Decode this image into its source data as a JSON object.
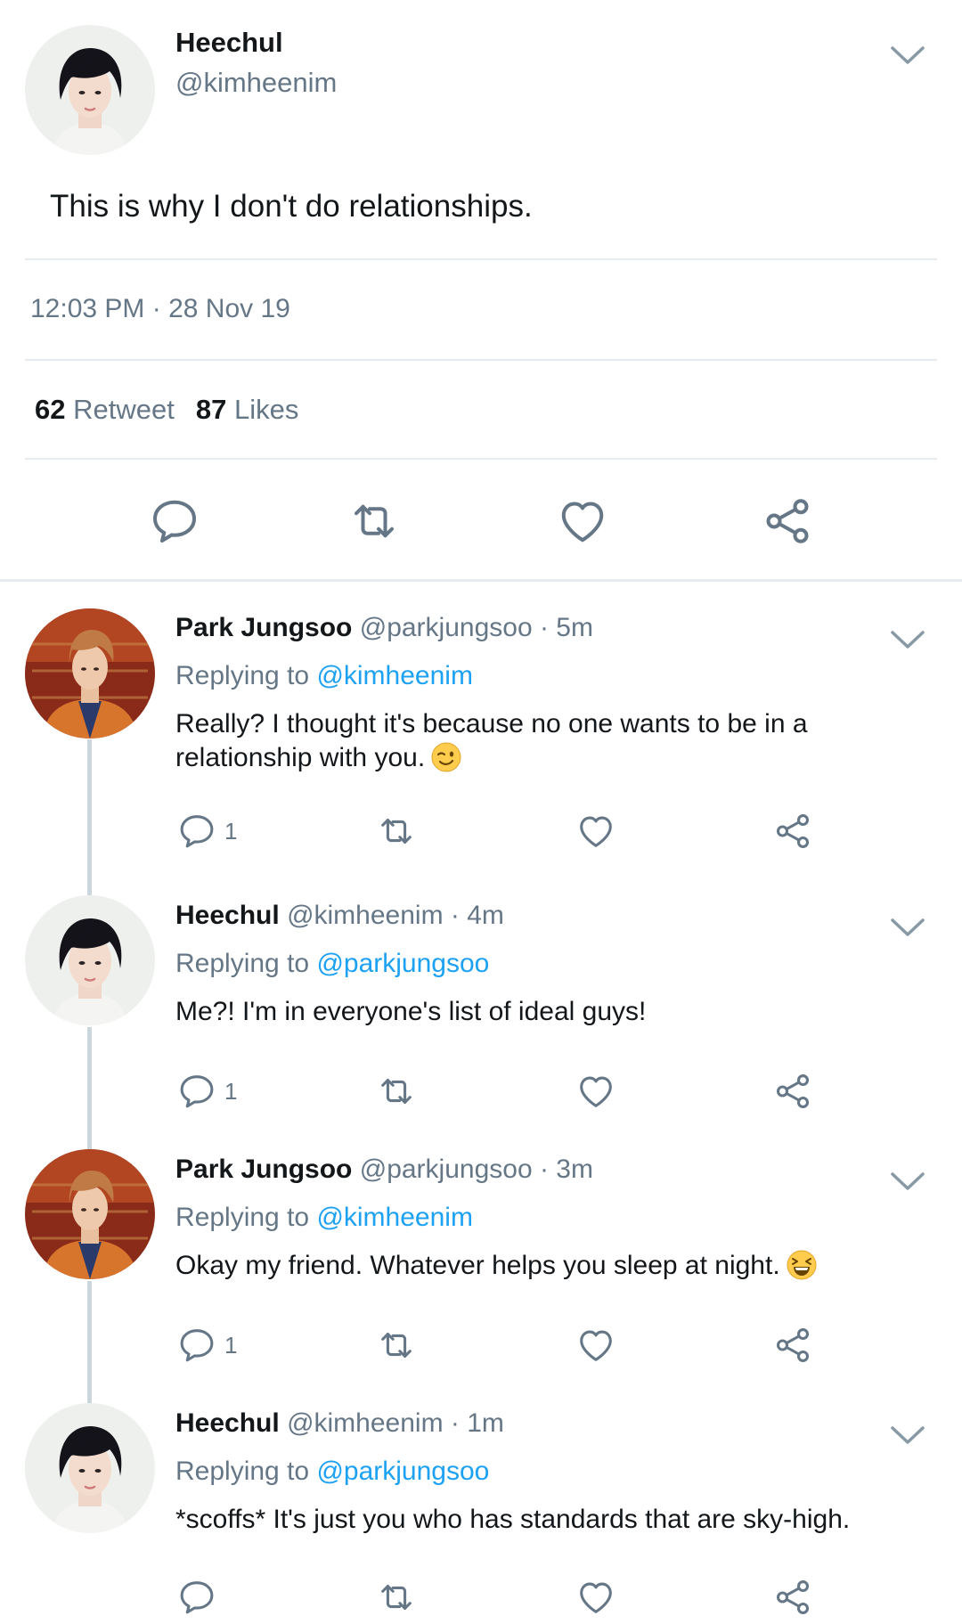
{
  "main_tweet": {
    "name": "Heechul",
    "handle": "@kimheenim",
    "text": "This is why I don't do relationships.",
    "timestamp": "12:03 PM · 28 Nov 19",
    "retweets_count": "62",
    "retweets_label": "Retweet",
    "likes_count": "87",
    "likes_label": "Likes"
  },
  "replies": [
    {
      "name": "Park Jungsoo",
      "meta": "@parkjungsoo · 5m",
      "replying_prefix": "Replying to",
      "replying_to": "@kimheenim",
      "text": "Really? I thought it's because no one wants to be in a relationship with you.",
      "emoji": "winking-face",
      "reply_count": "1"
    },
    {
      "name": "Heechul",
      "meta": "@kimheenim · 4m",
      "replying_prefix": "Replying to",
      "replying_to": "@parkjungsoo",
      "text": "Me?! I'm in everyone's list of ideal guys!",
      "reply_count": "1"
    },
    {
      "name": "Park Jungsoo",
      "meta": "@parkjungsoo · 3m",
      "replying_prefix": "Replying to",
      "replying_to": "@kimheenim",
      "text": "Okay my friend. Whatever helps you sleep at night.",
      "emoji": "grinning-squinting-face",
      "reply_count": "1"
    },
    {
      "name": "Heechul",
      "meta": "@kimheenim · 1m",
      "replying_prefix": "Replying to",
      "replying_to": "@parkjungsoo",
      "text": "*scoffs* It's just you who has standards that are sky-high.",
      "reply_count": ""
    }
  ],
  "icons": [
    "reply-icon",
    "retweet-icon",
    "like-icon",
    "share-icon",
    "chevron-down-icon"
  ],
  "colors": {
    "text": "#14171a",
    "secondary": "#657786",
    "link": "#1da1f2",
    "divider": "#e6ecf0",
    "thread": "#ccd6dd"
  }
}
